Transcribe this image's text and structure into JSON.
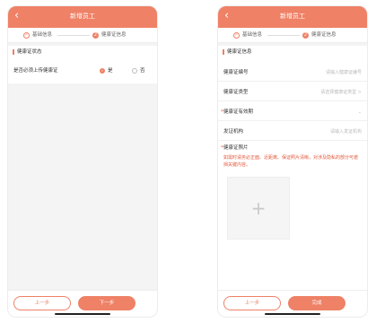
{
  "screen1": {
    "title": "新增员工",
    "steps": [
      {
        "label": "基础信息",
        "mark": "✓"
      },
      {
        "label": "健康证信息",
        "mark": "2"
      }
    ],
    "section": "健康证状态",
    "question": "是否必须上传健康证",
    "options": [
      {
        "label": "是",
        "selected": true
      },
      {
        "label": "否",
        "selected": false
      }
    ],
    "prev_button": "上一步",
    "next_button": "下一步"
  },
  "screen2": {
    "title": "新增员工",
    "steps": [
      {
        "label": "基础信息",
        "mark": "✓"
      },
      {
        "label": "健康证信息",
        "mark": "2"
      }
    ],
    "section": "健康证信息",
    "fields": [
      {
        "label": "健康证编号",
        "placeholder": "请输入健康证编号",
        "required": false
      },
      {
        "label": "健康证类型",
        "placeholder": "请选择健康证类型 >",
        "required": false
      },
      {
        "label": "健康证有效期",
        "placeholder": "⌄",
        "required": true
      },
      {
        "label": "发证机构",
        "placeholder": "请输入发证机构",
        "required": false
      }
    ],
    "photo_label": "健康证照片",
    "warning": "如需时请务必正面、近距离、保证照片清晰，对涉及隐私的部分可遮挡关键内容。",
    "upload_icon": "plus-icon",
    "prev_button": "上一步",
    "done_button": "完成"
  },
  "colors": {
    "accent": "#ee8166",
    "warning": "#e0583b"
  }
}
